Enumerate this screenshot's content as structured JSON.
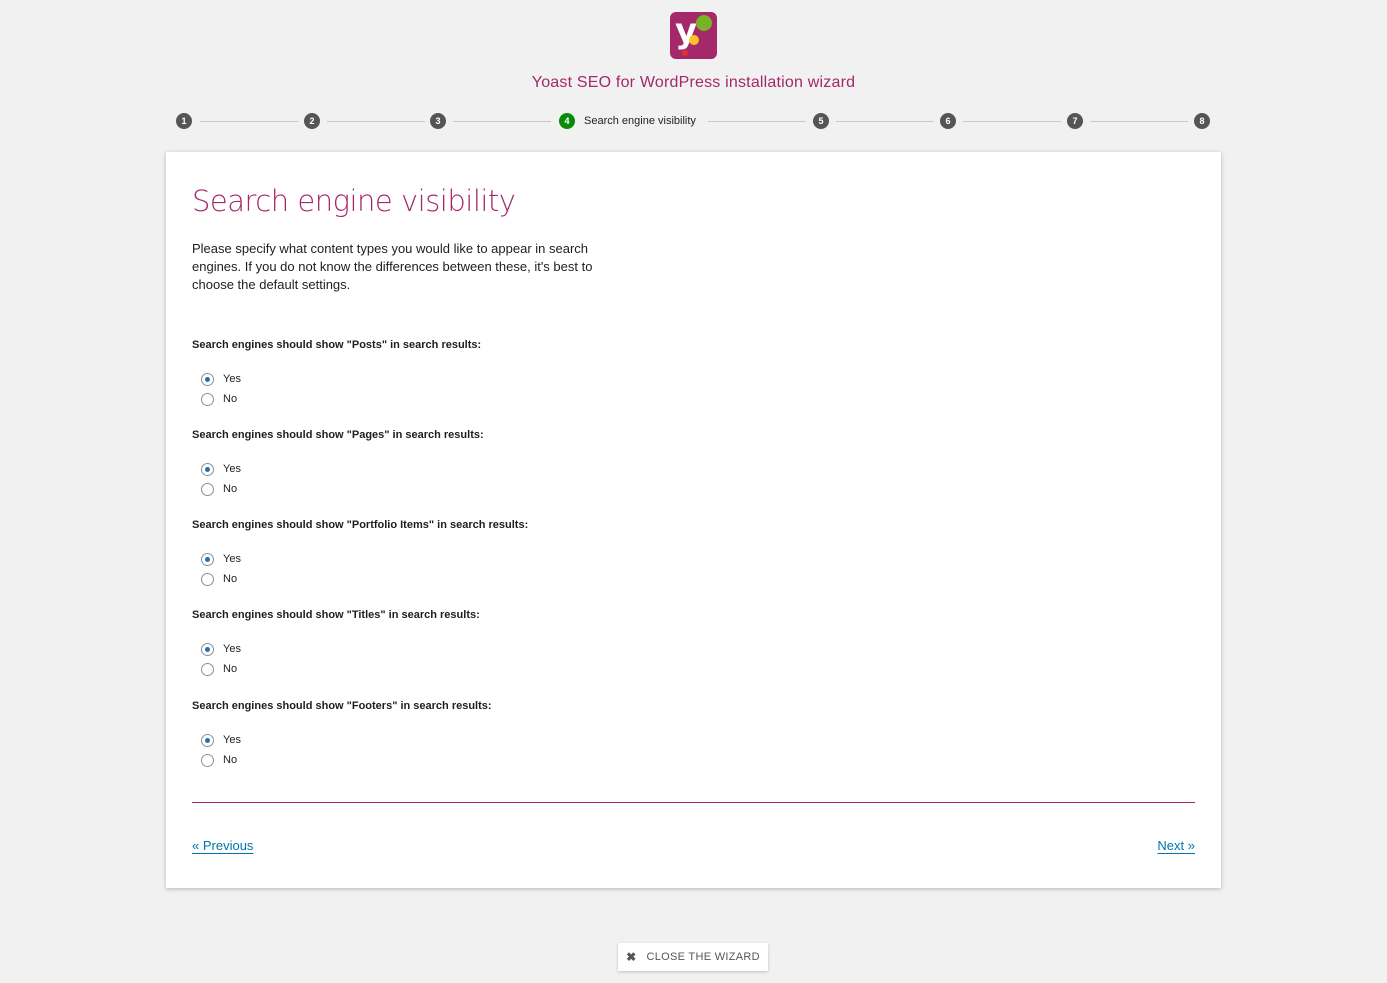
{
  "header": {
    "logo_icon": "yoast-logo-icon",
    "title": "Yoast SEO for WordPress installation wizard"
  },
  "stepper": {
    "active_step": 4,
    "steps": [
      {
        "number": "1",
        "label": ""
      },
      {
        "number": "2",
        "label": ""
      },
      {
        "number": "3",
        "label": ""
      },
      {
        "number": "4",
        "label": "Search engine visibility"
      },
      {
        "number": "5",
        "label": ""
      },
      {
        "number": "6",
        "label": ""
      },
      {
        "number": "7",
        "label": ""
      },
      {
        "number": "8",
        "label": ""
      }
    ]
  },
  "main": {
    "heading": "Search engine visibility",
    "intro": "Please specify what content types you would like to appear in search engines. If you do not know the differences between these, it's best to choose the default settings.",
    "questions": [
      {
        "label": "Search engines should show \"Posts\" in search results:",
        "options": [
          "Yes",
          "No"
        ],
        "selected": "Yes"
      },
      {
        "label": "Search engines should show \"Pages\" in search results:",
        "options": [
          "Yes",
          "No"
        ],
        "selected": "Yes"
      },
      {
        "label": "Search engines should show \"Portfolio Items\" in search results:",
        "options": [
          "Yes",
          "No"
        ],
        "selected": "Yes"
      },
      {
        "label": "Search engines should show \"Titles\" in search results:",
        "options": [
          "Yes",
          "No"
        ],
        "selected": "Yes"
      },
      {
        "label": "Search engines should show \"Footers\" in search results:",
        "options": [
          "Yes",
          "No"
        ],
        "selected": "Yes"
      }
    ],
    "previous_label": "« Previous",
    "next_label": "Next »"
  },
  "footer": {
    "close_icon": "close-icon",
    "close_label": "CLOSE THE WIZARD"
  },
  "colors": {
    "brand": "#a4286a",
    "active_step": "#0a8a0a",
    "link": "#0073aa",
    "radio_checked": "#2271b1"
  }
}
